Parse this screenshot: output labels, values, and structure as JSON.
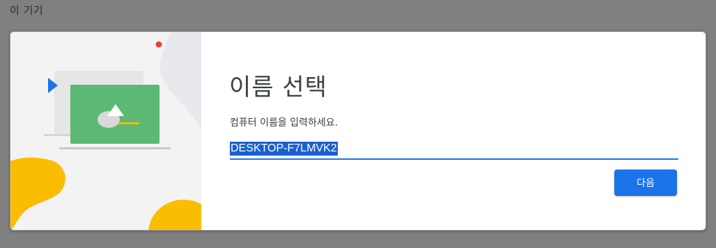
{
  "window": {
    "title": "이 기기"
  },
  "dialog": {
    "title": "이름 선택",
    "subtitle": "컴퓨터 이름을 입력하세요.",
    "name_input": {
      "value": "DESKTOP-F7LMVK2",
      "selected": true
    },
    "next_button_label": "다음"
  },
  "colors": {
    "accent": "#1a73e8",
    "selection": "#1a5fcf",
    "illustration_green": "#5bb974",
    "illustration_yellow": "#fbbc04",
    "illustration_red": "#ea4335"
  },
  "icons": [
    "laptop-illustration",
    "play-arrow-icon",
    "red-dot"
  ]
}
